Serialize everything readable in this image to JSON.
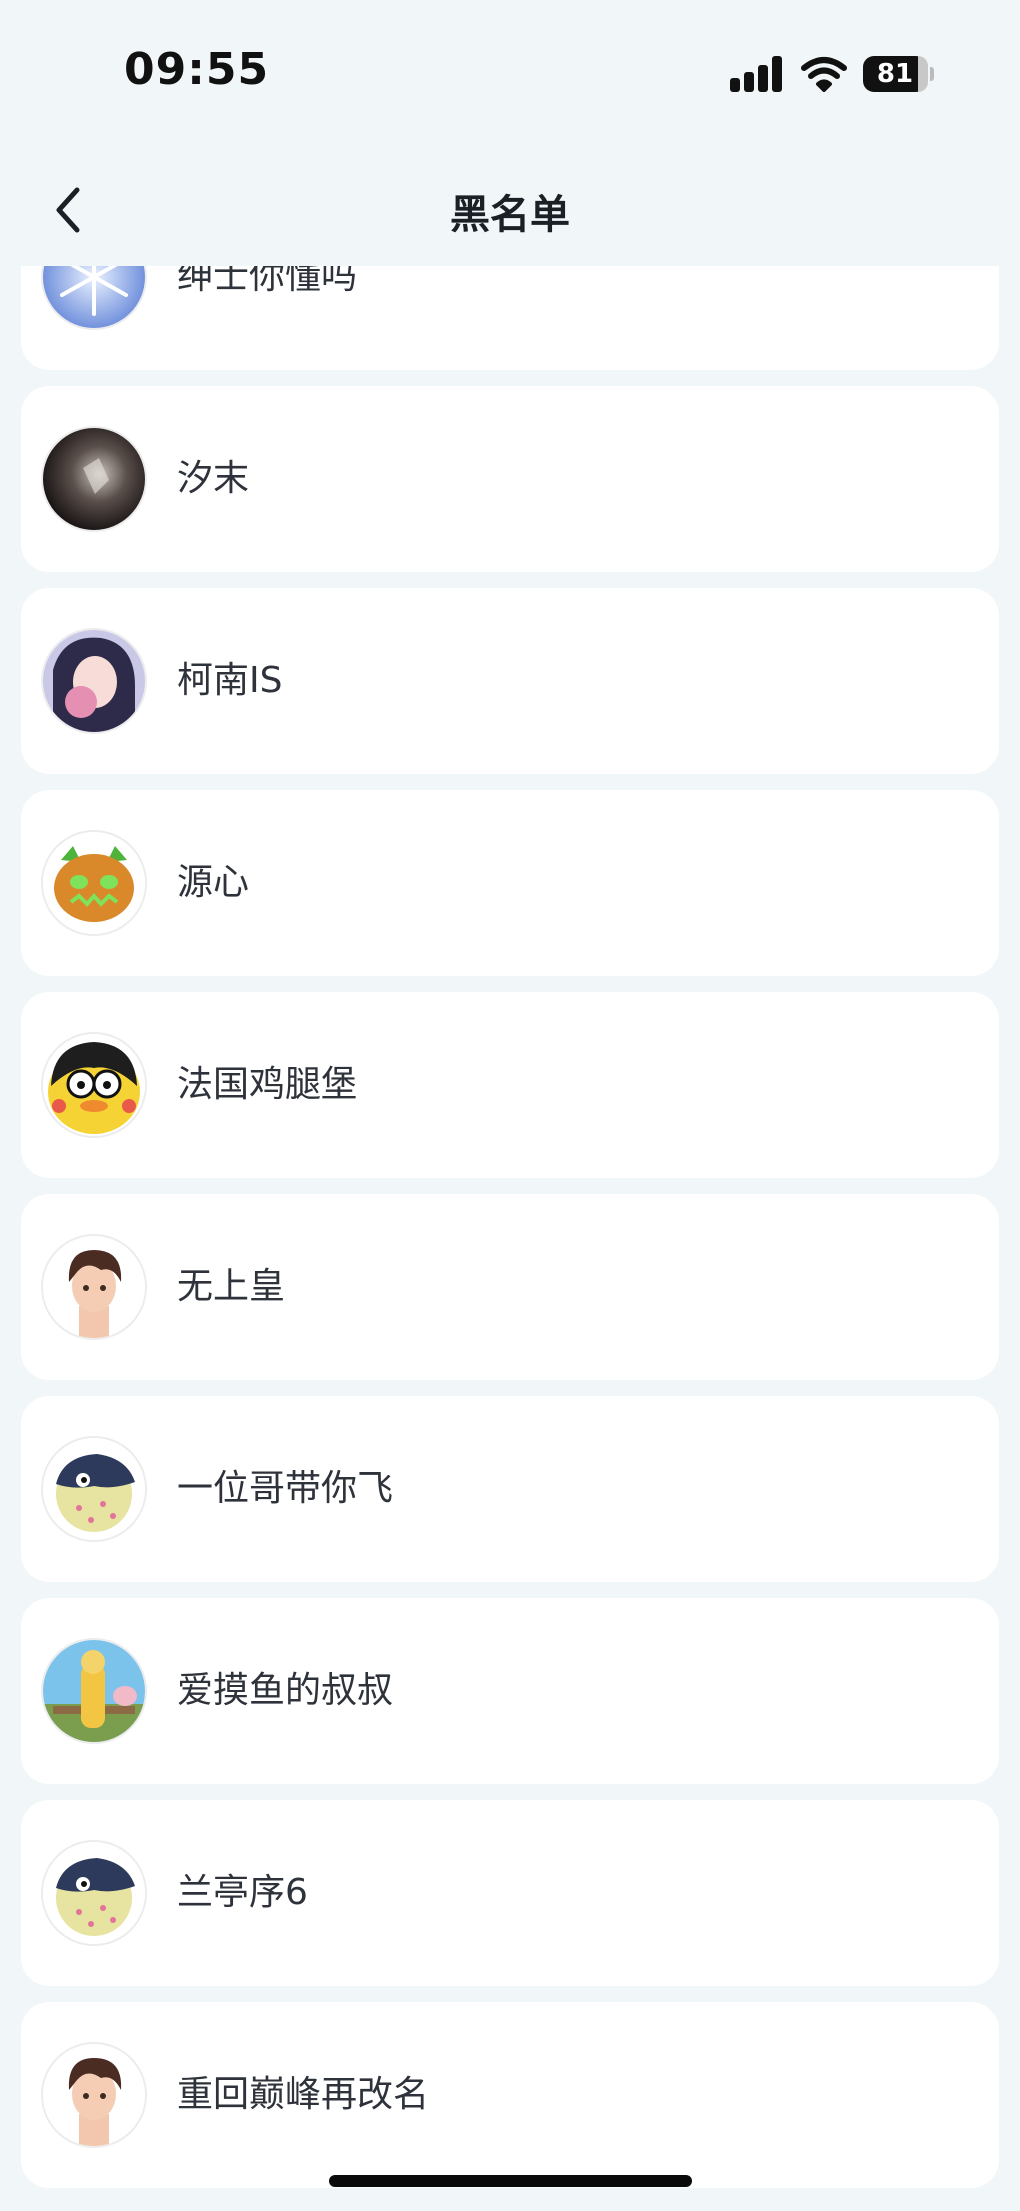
{
  "status_bar": {
    "time": "09:55",
    "battery": "81"
  },
  "header": {
    "title": "黑名单",
    "back_icon": "chevron-left-icon"
  },
  "blocked_users": [
    {
      "name": "绅士你懂吗",
      "avatar": "snowflake-avatar"
    },
    {
      "name": "汐末",
      "avatar": "dark-figure-avatar"
    },
    {
      "name": "柯南IS",
      "avatar": "anime-girl-avatar"
    },
    {
      "name": "源心",
      "avatar": "pumpkin-cat-avatar"
    },
    {
      "name": "法国鸡腿堡",
      "avatar": "cartoon-duck-avatar"
    },
    {
      "name": "无上皇",
      "avatar": "boy-character-avatar"
    },
    {
      "name": "一位哥带你飞",
      "avatar": "pufferfish-avatar"
    },
    {
      "name": "爱摸鱼的叔叔",
      "avatar": "yellow-outfit-avatar"
    },
    {
      "name": "兰亭序6",
      "avatar": "pufferfish-avatar"
    },
    {
      "name": "重回巅峰再改名",
      "avatar": "boy-character-avatar"
    }
  ]
}
